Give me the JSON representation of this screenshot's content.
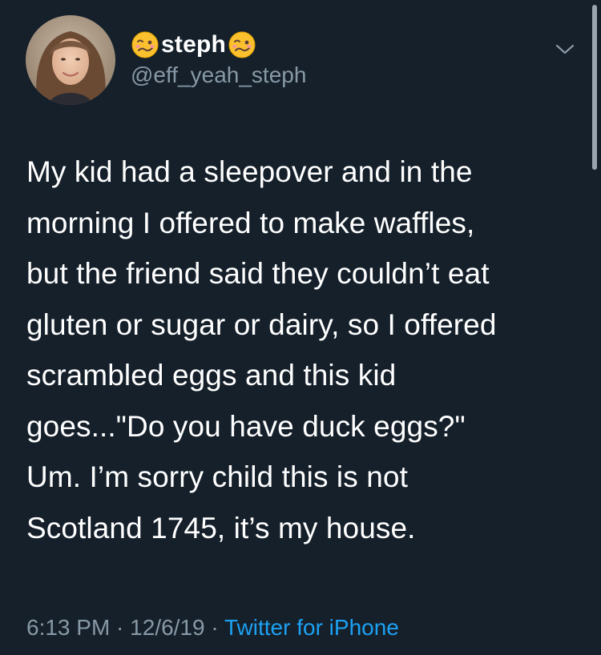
{
  "user": {
    "display_name": "steph",
    "handle": "@eff_yeah_steph",
    "name_emoji": "woozy-face"
  },
  "tweet": {
    "lines": [
      "My kid had a sleepover and in the",
      "morning I offered to make waffles,",
      "but the friend said they couldn’t eat",
      "gluten or sugar or dairy, so I offered",
      "scrambled eggs and this kid",
      "goes...\"Do you have duck eggs?\"",
      "Um. I’m sorry child this is not",
      "Scotland 1745, it’s my house."
    ]
  },
  "meta": {
    "time": "6:13 PM",
    "separator": " · ",
    "date": "12/6/19",
    "source": "Twitter for iPhone"
  },
  "colors": {
    "background": "#15202b",
    "text": "#ffffff",
    "secondary": "#8899a6",
    "link": "#1da1f2"
  }
}
